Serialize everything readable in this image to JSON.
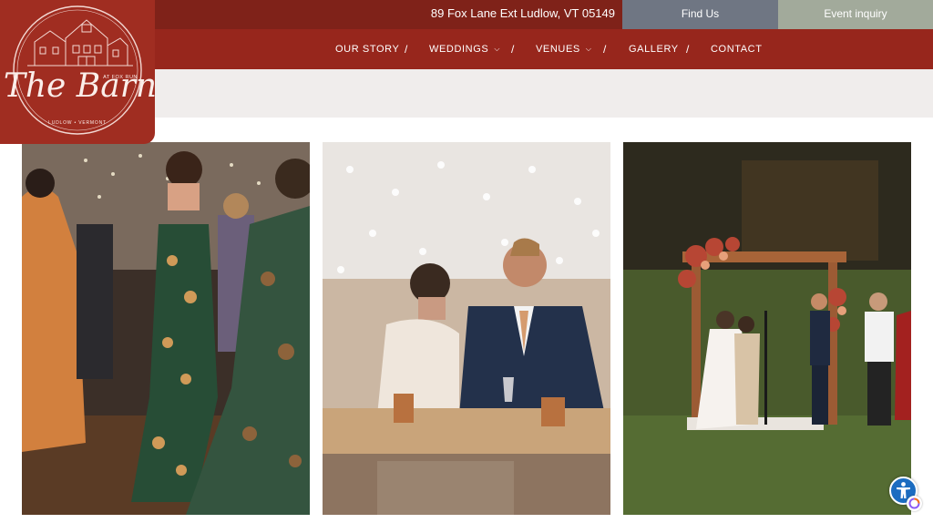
{
  "topbar": {
    "address": "89 Fox Lane Ext Ludlow, VT 05149",
    "find_us": "Find Us",
    "event_inquiry": "Event inquiry"
  },
  "nav": {
    "items": [
      {
        "label": "OUR STORY"
      },
      {
        "label": "WEDDINGS"
      },
      {
        "label": "VENUES"
      },
      {
        "label": "GALLERY"
      },
      {
        "label": "CONTACT"
      }
    ],
    "separator": "/"
  },
  "logo": {
    "name": "The Barn",
    "tagline": "AT FOX RUN",
    "location": "LUDLOW • VERMONT"
  },
  "gallery": {
    "photos": [
      "photo-dancing-guests",
      "photo-couple-toast",
      "photo-outdoor-ceremony"
    ]
  },
  "colors": {
    "topbar": "#7f2219",
    "navbar": "#97261c",
    "logo_bg": "#a02d21",
    "find_us_bg": "#6f7683",
    "event_inquiry_bg": "#a2aa9b",
    "banner": "#f0edec"
  },
  "icons": {
    "accessibility": "accessibility-icon",
    "chevron": "chevron-down-icon"
  }
}
